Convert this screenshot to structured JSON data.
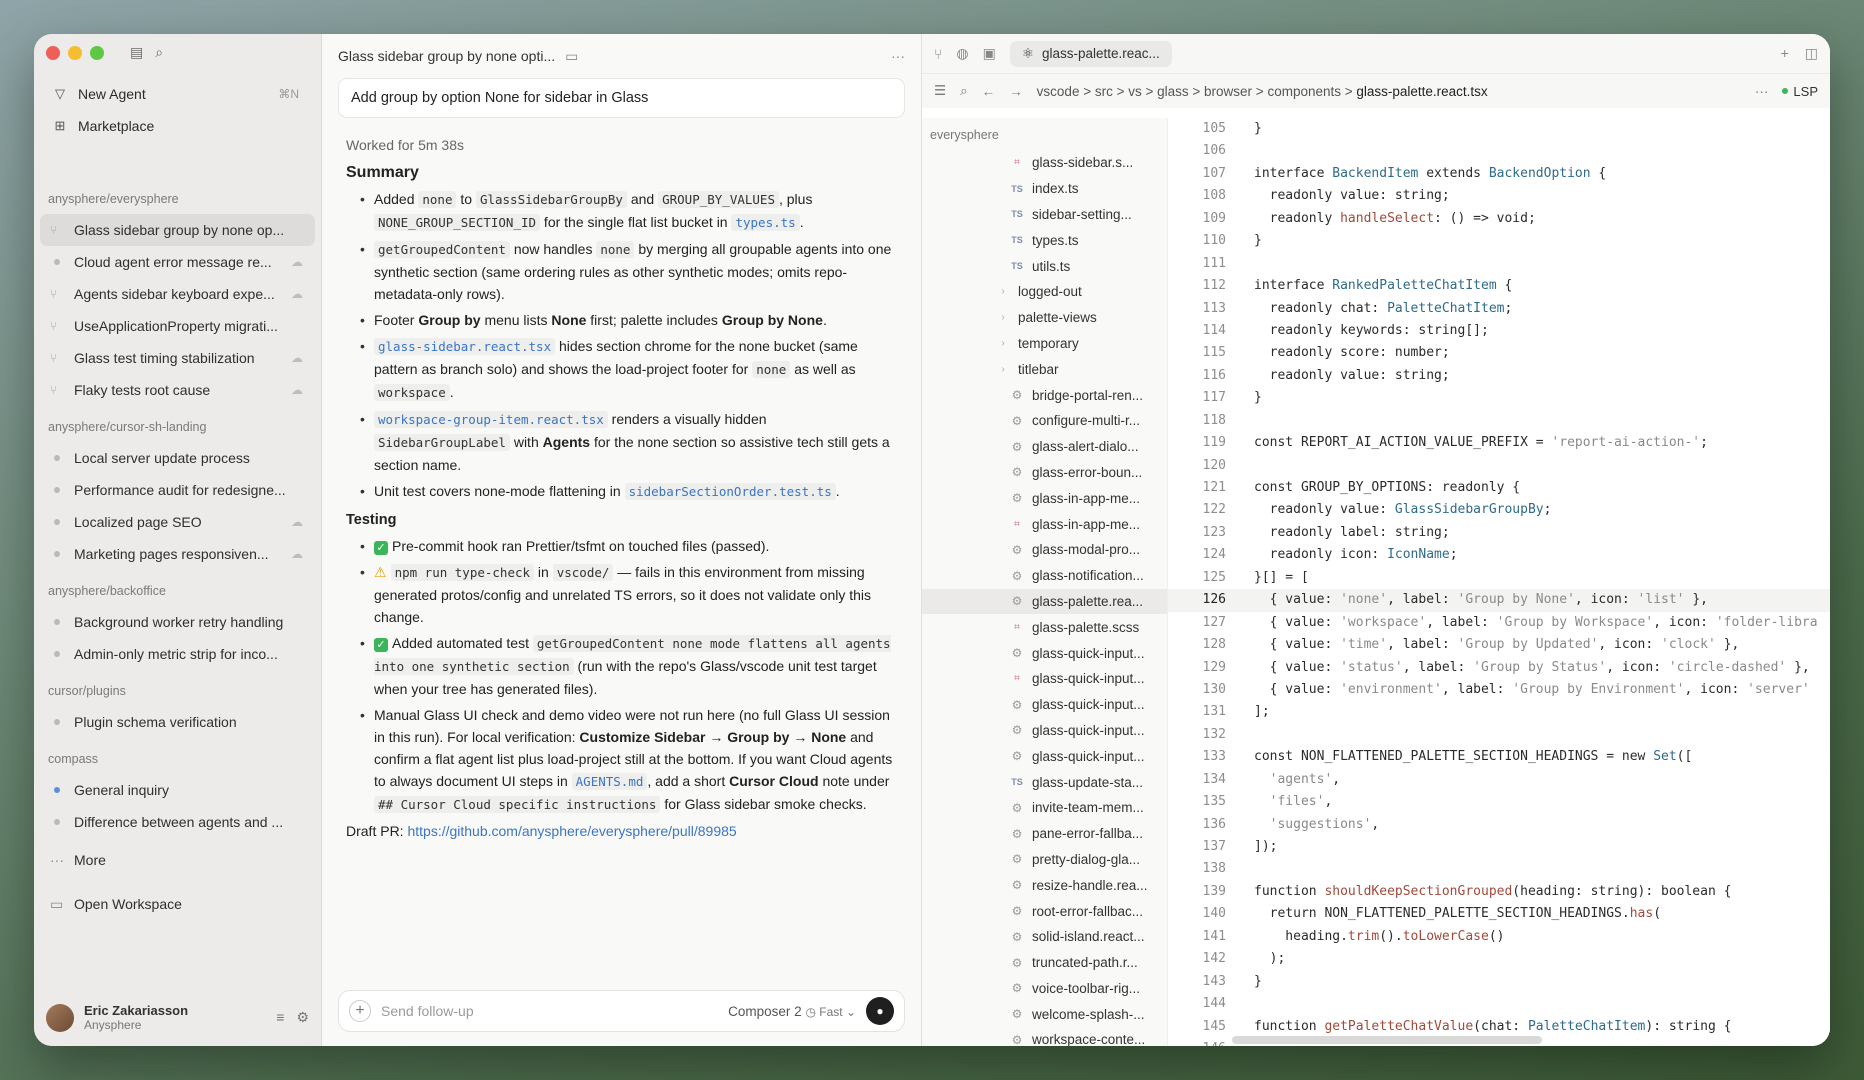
{
  "sidebar": {
    "new_agent": "New Agent",
    "new_agent_shortcut": "⌘N",
    "marketplace": "Marketplace",
    "groups": [
      {
        "label": "anysphere/everysphere",
        "items": [
          {
            "text": "Glass sidebar group by none op...",
            "active": true,
            "cloud": false,
            "icon": "branch"
          },
          {
            "text": "Cloud agent error message re...",
            "cloud": true,
            "icon": "dot"
          },
          {
            "text": "Agents sidebar keyboard expe...",
            "cloud": true,
            "icon": "branch"
          },
          {
            "text": "UseApplicationProperty migrati...",
            "cloud": false,
            "icon": "branch"
          },
          {
            "text": "Glass test timing stabilization",
            "cloud": true,
            "icon": "branch"
          },
          {
            "text": "Flaky tests root cause",
            "cloud": true,
            "icon": "branch"
          }
        ]
      },
      {
        "label": "anysphere/cursor-sh-landing",
        "items": [
          {
            "text": "Local server update process",
            "cloud": false,
            "icon": "dot"
          },
          {
            "text": "Performance audit for redesigne...",
            "cloud": false,
            "icon": "dot"
          },
          {
            "text": "Localized page SEO",
            "cloud": true,
            "icon": "dot"
          },
          {
            "text": "Marketing pages responsiven...",
            "cloud": true,
            "icon": "dot"
          }
        ]
      },
      {
        "label": "anysphere/backoffice",
        "items": [
          {
            "text": "Background worker retry handling",
            "cloud": false,
            "icon": "dot"
          },
          {
            "text": "Admin-only metric strip for inco...",
            "cloud": false,
            "icon": "dot"
          }
        ]
      },
      {
        "label": "cursor/plugins",
        "items": [
          {
            "text": "Plugin schema verification",
            "cloud": false,
            "icon": "dot"
          }
        ]
      },
      {
        "label": "compass",
        "items": [
          {
            "text": "General inquiry",
            "cloud": false,
            "icon": "dot-blue"
          },
          {
            "text": "Difference between agents and ...",
            "cloud": false,
            "icon": "dot"
          }
        ]
      }
    ],
    "more": "More",
    "open_workspace": "Open Workspace",
    "user": {
      "name": "Eric Zakariasson",
      "org": "Anysphere"
    }
  },
  "chat": {
    "title": "Glass sidebar group by none opti...",
    "prompt": "Add group by option None for sidebar in Glass",
    "worked": "Worked for 5m 38s",
    "summary_heading": "Summary",
    "summary": [
      {
        "parts": [
          [
            "t",
            "Added "
          ],
          [
            "c",
            "none"
          ],
          [
            "t",
            " to "
          ],
          [
            "c",
            "GlassSidebarGroupBy"
          ],
          [
            "t",
            " and "
          ],
          [
            "c",
            "GROUP_BY_VALUES"
          ],
          [
            "t",
            ", plus "
          ],
          [
            "c",
            "NONE_GROUP_SECTION_ID"
          ],
          [
            "t",
            " for the single flat list bucket in "
          ],
          [
            "l",
            "types.ts"
          ],
          [
            "t",
            "."
          ]
        ]
      },
      {
        "parts": [
          [
            "c",
            "getGroupedContent"
          ],
          [
            "t",
            " now handles "
          ],
          [
            "c",
            "none"
          ],
          [
            "t",
            " by merging all groupable agents into one synthetic section (same ordering rules as other synthetic modes; omits repo-metadata-only rows)."
          ]
        ]
      },
      {
        "parts": [
          [
            "t",
            "Footer "
          ],
          [
            "b",
            "Group by"
          ],
          [
            "t",
            " menu lists "
          ],
          [
            "b",
            "None"
          ],
          [
            "t",
            " first; palette includes "
          ],
          [
            "b",
            "Group by None"
          ],
          [
            "t",
            "."
          ]
        ]
      },
      {
        "parts": [
          [
            "l",
            "glass-sidebar.react.tsx"
          ],
          [
            "t",
            " hides section chrome for the none bucket (same pattern as branch solo) and shows the load-project footer for "
          ],
          [
            "c",
            "none"
          ],
          [
            "t",
            " as well as "
          ],
          [
            "c",
            "workspace"
          ],
          [
            "t",
            "."
          ]
        ]
      },
      {
        "parts": [
          [
            "l",
            "workspace-group-item.react.tsx"
          ],
          [
            "t",
            " renders a visually hidden "
          ],
          [
            "c",
            "SidebarGroupLabel"
          ],
          [
            "t",
            " with "
          ],
          [
            "b",
            "Agents"
          ],
          [
            "t",
            " for the none section so assistive tech still gets a section name."
          ]
        ]
      },
      {
        "parts": [
          [
            "t",
            "Unit test covers none-mode flattening in "
          ],
          [
            "l",
            "sidebarSectionOrder.test.ts"
          ],
          [
            "t",
            "."
          ]
        ]
      }
    ],
    "testing_heading": "Testing",
    "testing": [
      {
        "parts": [
          [
            "k",
            "✓"
          ],
          [
            "t",
            "Pre-commit hook ran Prettier/tsfmt on touched files (passed)."
          ]
        ]
      },
      {
        "parts": [
          [
            "w",
            "⚠"
          ],
          [
            "c",
            "npm run type-check"
          ],
          [
            "t",
            " in "
          ],
          [
            "c",
            "vscode/"
          ],
          [
            "t",
            " — fails in this environment from missing generated protos/config and unrelated TS errors, so it does not validate only this change."
          ]
        ]
      },
      {
        "parts": [
          [
            "k",
            "✓"
          ],
          [
            "t",
            "Added automated test "
          ],
          [
            "c",
            "getGroupedContent none mode flattens all agents into one synthetic section"
          ],
          [
            "t",
            " (run with the repo's Glass/vscode unit test target when your tree has generated files)."
          ]
        ]
      },
      {
        "parts": [
          [
            "t",
            "Manual Glass UI check and demo video were not run here (no full Glass UI session in this run). For local verification: "
          ],
          [
            "b",
            "Customize Sidebar → Group by → None"
          ],
          [
            "t",
            " and confirm a flat agent list plus load-project still at the bottom. If you want Cloud agents to always document UI steps in "
          ],
          [
            "l",
            "AGENTS.md"
          ],
          [
            "t",
            ", add a short "
          ],
          [
            "b",
            "Cursor Cloud"
          ],
          [
            "t",
            " note under "
          ],
          [
            "c",
            "## Cursor Cloud specific instructions"
          ],
          [
            "t",
            " for Glass sidebar smoke checks."
          ]
        ]
      }
    ],
    "draft_label": "Draft PR: ",
    "draft_link": "https://github.com/anysphere/everysphere/pull/89985",
    "composer_placeholder": "Send follow-up",
    "model": "Composer 2",
    "speed": "Fast"
  },
  "editor": {
    "tab": "glass-palette.reac...",
    "breadcrumb": [
      "vscode",
      "src",
      "vs",
      "glass",
      "browser",
      "components",
      "glass-palette.react.tsx"
    ],
    "lsp": "LSP",
    "tree_root": "everysphere",
    "files": [
      {
        "name": "glass-sidebar.s...",
        "icon": "scss"
      },
      {
        "name": "index.ts",
        "icon": "ts"
      },
      {
        "name": "sidebar-setting...",
        "icon": "ts"
      },
      {
        "name": "types.ts",
        "icon": "ts"
      },
      {
        "name": "utils.ts",
        "icon": "ts"
      },
      {
        "name": "logged-out",
        "icon": "dir"
      },
      {
        "name": "palette-views",
        "icon": "dir"
      },
      {
        "name": "temporary",
        "icon": "dir"
      },
      {
        "name": "titlebar",
        "icon": "dir"
      },
      {
        "name": "bridge-portal-ren...",
        "icon": "gear"
      },
      {
        "name": "configure-multi-r...",
        "icon": "gear"
      },
      {
        "name": "glass-alert-dialo...",
        "icon": "gear"
      },
      {
        "name": "glass-error-boun...",
        "icon": "gear"
      },
      {
        "name": "glass-in-app-me...",
        "icon": "gear"
      },
      {
        "name": "glass-in-app-me...",
        "icon": "scss"
      },
      {
        "name": "glass-modal-pro...",
        "icon": "gear"
      },
      {
        "name": "glass-notification...",
        "icon": "gear"
      },
      {
        "name": "glass-palette.rea...",
        "icon": "gear",
        "selected": true
      },
      {
        "name": "glass-palette.scss",
        "icon": "scss"
      },
      {
        "name": "glass-quick-input...",
        "icon": "gear"
      },
      {
        "name": "glass-quick-input...",
        "icon": "scss"
      },
      {
        "name": "glass-quick-input...",
        "icon": "gear"
      },
      {
        "name": "glass-quick-input...",
        "icon": "gear"
      },
      {
        "name": "glass-quick-input...",
        "icon": "gear"
      },
      {
        "name": "glass-update-sta...",
        "icon": "ts"
      },
      {
        "name": "invite-team-mem...",
        "icon": "gear"
      },
      {
        "name": "pane-error-fallba...",
        "icon": "gear"
      },
      {
        "name": "pretty-dialog-gla...",
        "icon": "gear"
      },
      {
        "name": "resize-handle.rea...",
        "icon": "gear"
      },
      {
        "name": "root-error-fallbac...",
        "icon": "gear"
      },
      {
        "name": "solid-island.react...",
        "icon": "gear"
      },
      {
        "name": "truncated-path.r...",
        "icon": "gear"
      },
      {
        "name": "voice-toolbar-rig...",
        "icon": "gear"
      },
      {
        "name": "welcome-splash-...",
        "icon": "gear"
      },
      {
        "name": "workspace-conte...",
        "icon": "gear"
      }
    ],
    "current_line": 126,
    "lines": [
      {
        "n": 105,
        "t": "}"
      },
      {
        "n": 106,
        "t": ""
      },
      {
        "n": 107,
        "t": "interface BackendItem extends BackendOption {"
      },
      {
        "n": 108,
        "t": "  readonly value: string;"
      },
      {
        "n": 109,
        "t": "  readonly handleSelect: () => void;"
      },
      {
        "n": 110,
        "t": "}"
      },
      {
        "n": 111,
        "t": ""
      },
      {
        "n": 112,
        "t": "interface RankedPaletteChatItem {"
      },
      {
        "n": 113,
        "t": "  readonly chat: PaletteChatItem;"
      },
      {
        "n": 114,
        "t": "  readonly keywords: string[];"
      },
      {
        "n": 115,
        "t": "  readonly score: number;"
      },
      {
        "n": 116,
        "t": "  readonly value: string;"
      },
      {
        "n": 117,
        "t": "}"
      },
      {
        "n": 118,
        "t": ""
      },
      {
        "n": 119,
        "t": "const REPORT_AI_ACTION_VALUE_PREFIX = 'report-ai-action-';"
      },
      {
        "n": 120,
        "t": ""
      },
      {
        "n": 121,
        "t": "const GROUP_BY_OPTIONS: readonly {"
      },
      {
        "n": 122,
        "t": "  readonly value: GlassSidebarGroupBy;"
      },
      {
        "n": 123,
        "t": "  readonly label: string;"
      },
      {
        "n": 124,
        "t": "  readonly icon: IconName;"
      },
      {
        "n": 125,
        "t": "}[] = ["
      },
      {
        "n": 126,
        "t": "  { value: 'none', label: 'Group by None', icon: 'list' },"
      },
      {
        "n": 127,
        "t": "  { value: 'workspace', label: 'Group by Workspace', icon: 'folder-libra"
      },
      {
        "n": 128,
        "t": "  { value: 'time', label: 'Group by Updated', icon: 'clock' },"
      },
      {
        "n": 129,
        "t": "  { value: 'status', label: 'Group by Status', icon: 'circle-dashed' },"
      },
      {
        "n": 130,
        "t": "  { value: 'environment', label: 'Group by Environment', icon: 'server'"
      },
      {
        "n": 131,
        "t": "];"
      },
      {
        "n": 132,
        "t": ""
      },
      {
        "n": 133,
        "t": "const NON_FLATTENED_PALETTE_SECTION_HEADINGS = new Set(["
      },
      {
        "n": 134,
        "t": "  'agents',"
      },
      {
        "n": 135,
        "t": "  'files',"
      },
      {
        "n": 136,
        "t": "  'suggestions',"
      },
      {
        "n": 137,
        "t": "]);"
      },
      {
        "n": 138,
        "t": ""
      },
      {
        "n": 139,
        "t": "function shouldKeepSectionGrouped(heading: string): boolean {"
      },
      {
        "n": 140,
        "t": "  return NON_FLATTENED_PALETTE_SECTION_HEADINGS.has("
      },
      {
        "n": 141,
        "t": "    heading.trim().toLowerCase()"
      },
      {
        "n": 142,
        "t": "  );"
      },
      {
        "n": 143,
        "t": "}"
      },
      {
        "n": 144,
        "t": ""
      },
      {
        "n": 145,
        "t": "function getPaletteChatValue(chat: PaletteChatItem): string {"
      },
      {
        "n": 146,
        "t": ""
      }
    ]
  }
}
